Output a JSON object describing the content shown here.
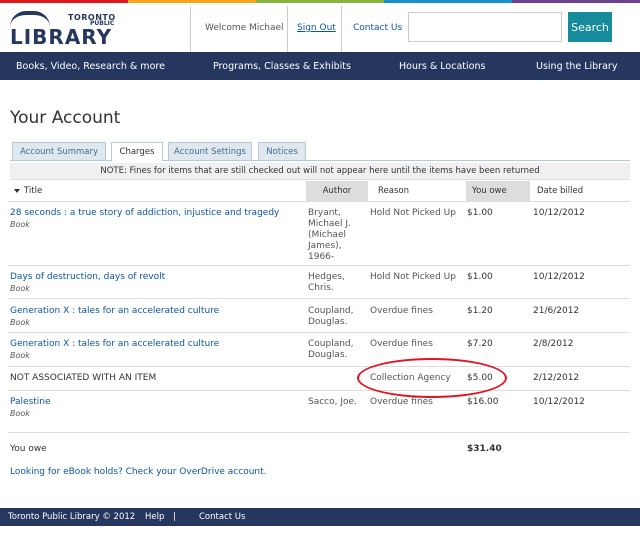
{
  "brand": {
    "name_top": "TORONTO",
    "name_mid": "PUBLIC",
    "name_main": "LIBRARY",
    "colors": [
      "#e1181e",
      "#f6a31d",
      "#87b43c",
      "#1a8fc9",
      "#6f3f8f"
    ]
  },
  "header": {
    "welcome": "Welcome Michael",
    "sign_out": "Sign Out",
    "contact_us": "Contact Us",
    "search_value": "",
    "search_button": "Search"
  },
  "nav": {
    "items": [
      "Books, Video, Research & more",
      "Programs, Classes & Exhibits",
      "Hours & Locations",
      "Using the Library"
    ]
  },
  "page": {
    "title": "Your Account",
    "tabs": [
      "Account Summary",
      "Charges",
      "Account Settings",
      "Notices"
    ],
    "active_tab": "Charges",
    "note": "NOTE: Fines for items that are still checked out will not appear here until the items have been returned"
  },
  "table": {
    "headers": {
      "title": "Title",
      "author": "Author",
      "reason": "Reason",
      "owe": "You owe",
      "date": "Date billed"
    },
    "rows": [
      {
        "title": "28 seconds : a true story of addiction, injustice and tragedy",
        "type": "Book",
        "author": "Bryant, Michael J. (Michael James), 1966-",
        "reason": "Hold Not Picked Up",
        "owe": "$1.00",
        "date": "10/12/2012"
      },
      {
        "title": "Days of destruction, days of revolt",
        "type": "Book",
        "author": "Hedges, Chris.",
        "reason": "Hold Not Picked Up",
        "owe": "$1.00",
        "date": "10/12/2012"
      },
      {
        "title": "Generation X : tales for an accelerated culture",
        "type": "Book",
        "author": "Coupland, Douglas.",
        "reason": "Overdue fines",
        "owe": "$1.20",
        "date": "21/6/2012"
      },
      {
        "title": "Generation X : tales for an accelerated culture",
        "type": "Book",
        "author": "Coupland, Douglas.",
        "reason": "Overdue fines",
        "owe": "$7.20",
        "date": "2/8/2012"
      },
      {
        "title": "NOT ASSOCIATED WITH AN ITEM",
        "type": "",
        "author": "",
        "reason": "Collection Agency",
        "owe": "$5.00",
        "date": "2/12/2012"
      },
      {
        "title": "Palestine",
        "type": "Book",
        "author": "Sacco, Joe.",
        "reason": "Overdue fines",
        "owe": "$16.00",
        "date": "10/12/2012"
      }
    ],
    "total_label": "You owe",
    "total_value": "$31.40"
  },
  "ebook_link": "Looking for eBook holds? Check your OverDrive account.",
  "footer": {
    "copyright": "Toronto Public Library © 2012",
    "help": "Help",
    "separator": "|",
    "contact": "Contact Us"
  }
}
